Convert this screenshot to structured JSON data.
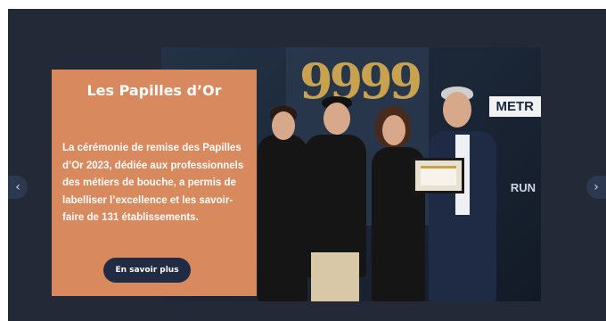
{
  "slide": {
    "title": "Les Papilles d’Or",
    "description": "La cérémonie de remise des Papilles d’Or 2023, dédiée aux professionnels des métiers de bouche, a permis de labelliser l’excellence et les savoir-faire de 131 établissements.",
    "cta_label": "En savoir plus"
  },
  "photo": {
    "backdrop_number": "9999",
    "sign_text": "METR",
    "side_text": "RUN"
  },
  "nav": {
    "prev_icon": "chevron-left-icon",
    "next_icon": "chevron-right-icon",
    "prev_glyph": "‹",
    "next_glyph": "›"
  },
  "colors": {
    "background": "#232936",
    "card": "#d9895e",
    "button": "#222b44",
    "gold": "#c9a24f"
  }
}
